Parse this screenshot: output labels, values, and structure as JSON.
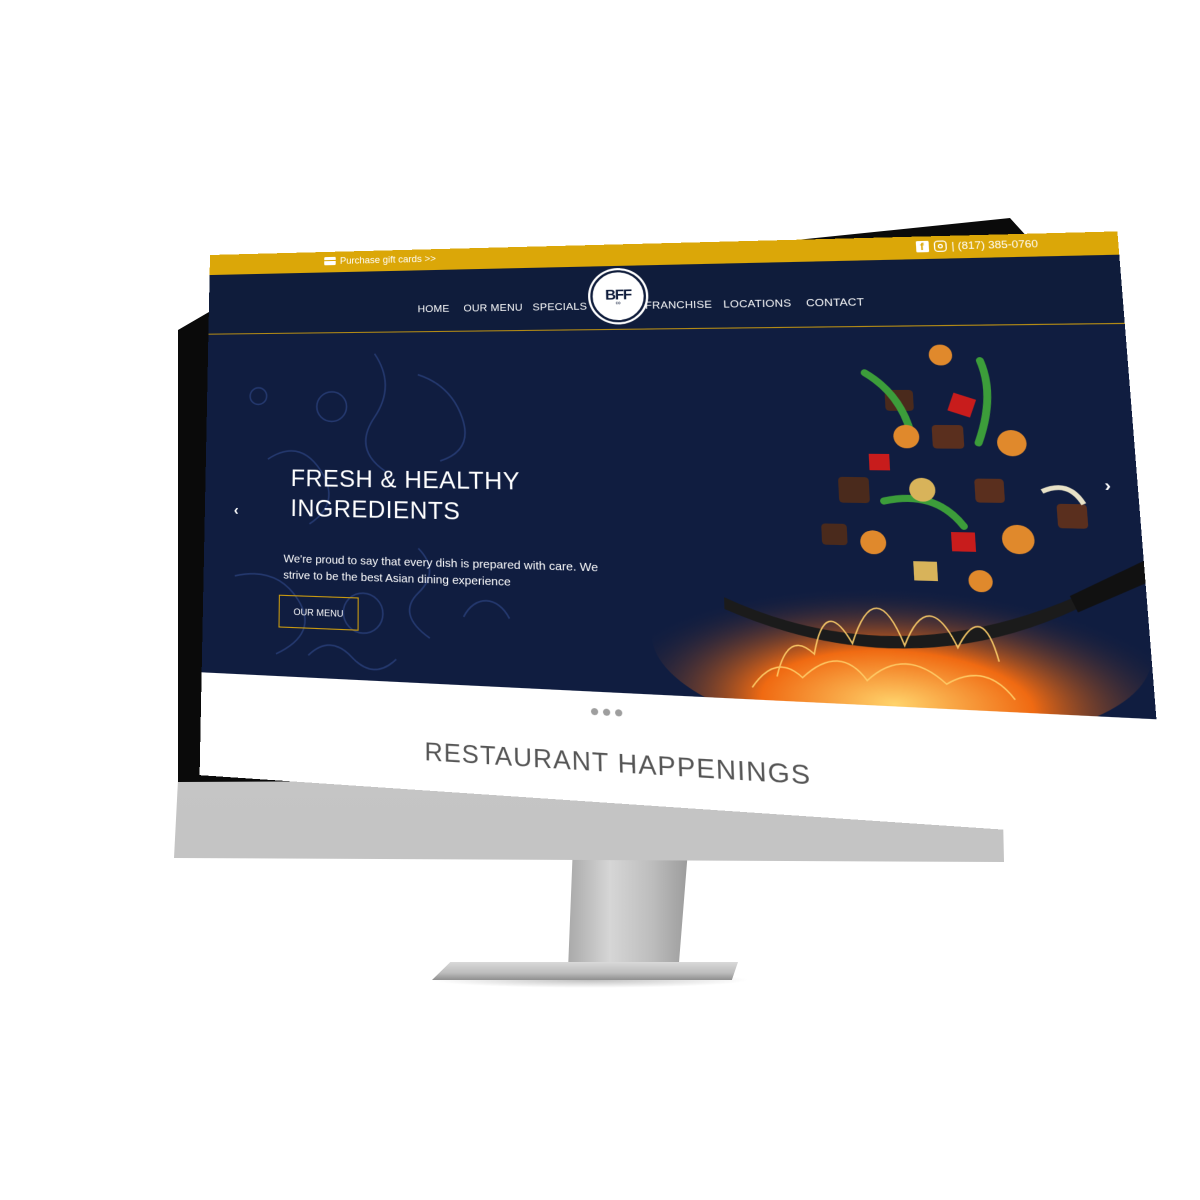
{
  "topbar": {
    "gift_label": "Purchase gift cards >>",
    "phone": "| (817) 385-0760",
    "facebook_glyph": "f",
    "icons": [
      "card-icon",
      "facebook-icon",
      "instagram-icon"
    ],
    "bg_color": "#dba708"
  },
  "nav": {
    "items": [
      "HOME",
      "OUR MENU",
      "SPECIALS",
      "FRANCHISE",
      "LOCATIONS",
      "CONTACT"
    ],
    "logo_text": "BFF",
    "logo_sub": "∞",
    "bg_color": "#0f1c3b"
  },
  "hero": {
    "title_line1": "FRESH & HEALTHY",
    "title_line2": "INGREDIENTS",
    "subtitle": "We're proud to say that every dish is prepared with care. We strive to be the best Asian dining experience",
    "button_label": "OUR MENU",
    "prev_glyph": "‹",
    "next_glyph": "›",
    "accent_color": "#c99a10"
  },
  "slider": {
    "dot_count": 3
  },
  "section": {
    "title": "RESTAURANT HAPPENINGS"
  }
}
